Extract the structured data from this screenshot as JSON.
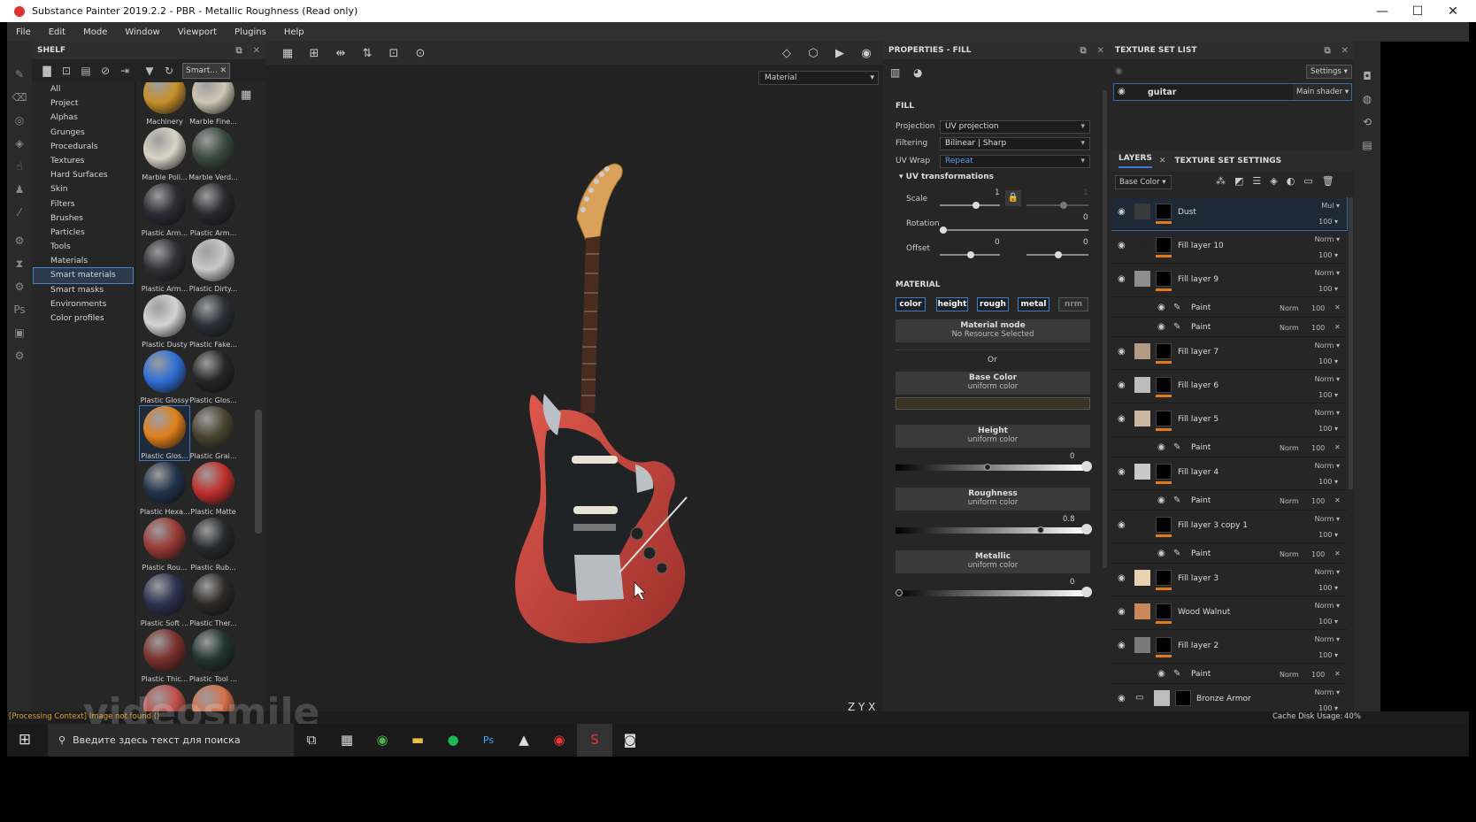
{
  "window": {
    "title": "Substance Painter 2019.2.2 - PBR - Metallic Roughness (Read only)",
    "min": "—",
    "max": "☐",
    "close": "✕"
  },
  "menu": [
    "File",
    "Edit",
    "Mode",
    "Window",
    "Viewport",
    "Plugins",
    "Help"
  ],
  "shelf": {
    "title": "SHELF",
    "search": "Smart...",
    "categories": [
      "All",
      "Project",
      "Alphas",
      "Grunges",
      "Procedurals",
      "Textures",
      "Hard Surfaces",
      "Skin",
      "Filters",
      "Brushes",
      "Particles",
      "Tools",
      "Materials",
      "Smart materials",
      "Smart masks",
      "Environments",
      "Color profiles"
    ],
    "selected_category": "Smart materials",
    "materials": [
      {
        "label": "Machinery",
        "color": "#c8902c"
      },
      {
        "label": "Marble Fine...",
        "color": "#cfc7b4"
      },
      {
        "label": "Marble Poli...",
        "color": "#d9d4c7"
      },
      {
        "label": "Marble Verd...",
        "color": "#3a4a3f"
      },
      {
        "label": "Plastic Arm...",
        "color": "#2c2c34"
      },
      {
        "label": "Plastic Arm...",
        "color": "#2a2a2e"
      },
      {
        "label": "Plastic Arm...",
        "color": "#303036"
      },
      {
        "label": "Plastic Dirty...",
        "color": "#c9c9c9"
      },
      {
        "label": "Plastic Dusty",
        "color": "#d4d4d4"
      },
      {
        "label": "Plastic Fake...",
        "color": "#2b2f37"
      },
      {
        "label": "Plastic Glossy",
        "color": "#2f6fd6"
      },
      {
        "label": "Plastic Glos...",
        "color": "#262626"
      },
      {
        "label": "Plastic Glos...",
        "color": "#e0801c"
      },
      {
        "label": "Plastic Grai...",
        "color": "#4a4430"
      },
      {
        "label": "Plastic Hexa...",
        "color": "#22324a"
      },
      {
        "label": "Plastic Matte",
        "color": "#c0302c"
      },
      {
        "label": "Plastic Rou...",
        "color": "#9a3a36"
      },
      {
        "label": "Plastic Rub...",
        "color": "#27292d"
      },
      {
        "label": "Plastic Soft ...",
        "color": "#2c3250"
      },
      {
        "label": "Plastic Ther...",
        "color": "#2c2a28"
      },
      {
        "label": "Plastic Thic...",
        "color": "#7a302c"
      },
      {
        "label": "Plastic Tool ...",
        "color": "#203630"
      },
      {
        "label": "",
        "color": "#c0504a"
      },
      {
        "label": "",
        "color": "#d4704a"
      }
    ],
    "selected_material_index": 12
  },
  "viewport": {
    "mode": "Material",
    "axes": "Z  Y  X"
  },
  "properties": {
    "title": "PROPERTIES - FILL",
    "fill_heading": "FILL",
    "projection_label": "Projection",
    "projection": "UV projection",
    "filtering_label": "Filtering",
    "filtering": "Bilinear | Sharp",
    "uvwrap_label": "UV Wrap",
    "uvwrap": "Repeat",
    "uvt_heading": "UV transformations",
    "scale_label": "Scale",
    "scale_value": "1",
    "scale_value2": "1",
    "rotation_label": "Rotation",
    "rotation_value": "0",
    "offset_label": "Offset",
    "offset_x": "0",
    "offset_y": "0",
    "material_heading": "MATERIAL",
    "channels": [
      "color",
      "height",
      "rough",
      "metal",
      "nrm"
    ],
    "material_mode": "Material mode",
    "no_resource": "No Resource Selected",
    "or": "Or",
    "base_color": "Base Color",
    "uniform": "uniform color",
    "base_color_hex": "#3b3226",
    "height": "Height",
    "height_value": "0",
    "roughness": "Roughness",
    "roughness_value": "0.8",
    "metallic": "Metallic",
    "metallic_value": "0"
  },
  "texture_set": {
    "title": "TEXTURE SET LIST",
    "settings": "Settings",
    "name": "guitar",
    "shader": "Main shader"
  },
  "layers_panel": {
    "tab_layers": "LAYERS",
    "tab_tss": "TEXTURE SET SETTINGS",
    "channel": "Base Color"
  },
  "layers": [
    {
      "type": "layer",
      "name": "Dust",
      "blend": "Mul",
      "opacity": "100",
      "thumb": "#3a3a3a",
      "selected": true
    },
    {
      "type": "layer",
      "name": "Fill layer 10",
      "blend": "Norm",
      "opacity": "100",
      "thumb": "#252525"
    },
    {
      "type": "layer",
      "name": "Fill layer 9",
      "blend": "Norm",
      "opacity": "100",
      "thumb": "#8e8e8e"
    },
    {
      "type": "sub",
      "name": "Paint",
      "blend": "Norm",
      "opacity": "100"
    },
    {
      "type": "sub",
      "name": "Paint",
      "blend": "Norm",
      "opacity": "100"
    },
    {
      "type": "layer",
      "name": "Fill layer 7",
      "blend": "Norm",
      "opacity": "100",
      "thumb": "#b39a82"
    },
    {
      "type": "layer",
      "name": "Fill layer 6",
      "blend": "Norm",
      "opacity": "100",
      "thumb": "#bcbcbc"
    },
    {
      "type": "layer",
      "name": "Fill layer 5",
      "blend": "Norm",
      "opacity": "100",
      "thumb": "#cdb7a0"
    },
    {
      "type": "sub",
      "name": "Paint",
      "blend": "Norm",
      "opacity": "100"
    },
    {
      "type": "layer",
      "name": "Fill layer 4",
      "blend": "Norm",
      "opacity": "100",
      "thumb": "#c8c8c8"
    },
    {
      "type": "sub",
      "name": "Paint",
      "blend": "Norm",
      "opacity": "100"
    },
    {
      "type": "layer",
      "name": "Fill layer 3 copy 1",
      "blend": "Norm",
      "opacity": "100",
      "thumb": "#262626"
    },
    {
      "type": "sub",
      "name": "Paint",
      "blend": "Norm",
      "opacity": "100"
    },
    {
      "type": "layer",
      "name": "Fill layer 3",
      "blend": "Norm",
      "opacity": "100",
      "thumb": "#e8d2b2"
    },
    {
      "type": "layer",
      "name": "Wood Walnut",
      "blend": "Norm",
      "opacity": "100",
      "thumb": "#c9885a"
    },
    {
      "type": "layer",
      "name": "Fill layer 2",
      "blend": "Norm",
      "opacity": "100",
      "thumb": "#7a7a7a"
    },
    {
      "type": "sub",
      "name": "Paint",
      "blend": "Norm",
      "opacity": "100"
    },
    {
      "type": "folder",
      "name": "Bronze Armor",
      "blend": "Norm",
      "opacity": "100",
      "thumb": "#bdbdbd"
    }
  ],
  "status": {
    "message": "[Processing Context] Image not found ()",
    "cache": "Cache Disk Usage:",
    "cache_value": "40%",
    "watermark": "videosmile"
  },
  "taskbar": {
    "search_placeholder": "Введите здесь текст для поиска"
  }
}
